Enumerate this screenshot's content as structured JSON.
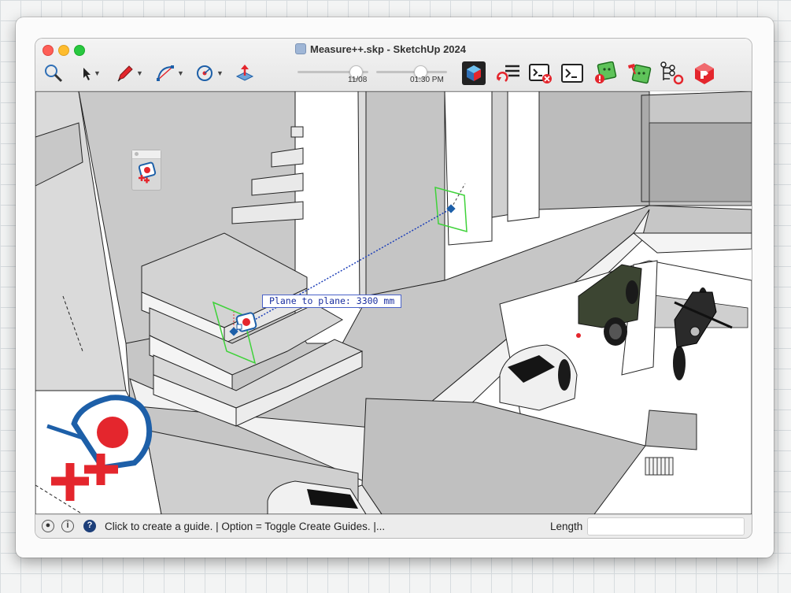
{
  "window": {
    "title": "Measure++.skp - SketchUp 2024"
  },
  "toolbar": {
    "tools": [
      {
        "name": "search-icon"
      },
      {
        "name": "select-arrow-icon"
      },
      {
        "name": "pencil-icon"
      },
      {
        "name": "arc-icon"
      },
      {
        "name": "rotate-icon"
      },
      {
        "name": "push-pull-icon"
      }
    ],
    "shadow_date": "11/08",
    "shadow_time": "01:30 PM",
    "shadow_date_fraction": 0.82,
    "shadow_time_fraction": 0.62,
    "plugin_icons": [
      {
        "name": "section-cube-icon"
      },
      {
        "name": "refresh-list-icon"
      },
      {
        "name": "console-close-icon"
      },
      {
        "name": "console-icon"
      },
      {
        "name": "warning-chip-icon"
      },
      {
        "name": "hammer-chip-icon"
      },
      {
        "name": "tree-node-icon"
      },
      {
        "name": "ruby-cube-icon"
      }
    ]
  },
  "viewport": {
    "measurement_tooltip": "Plane to plane: 3300 mm"
  },
  "statusbar": {
    "status_text": "Click to create a guide. | Option = Toggle Create Guides. |...",
    "length_label": "Length",
    "length_value": ""
  },
  "colors": {
    "accent_red": "#e4262d",
    "accent_blue": "#1d5fa8",
    "guide_green": "#3fd23a"
  }
}
